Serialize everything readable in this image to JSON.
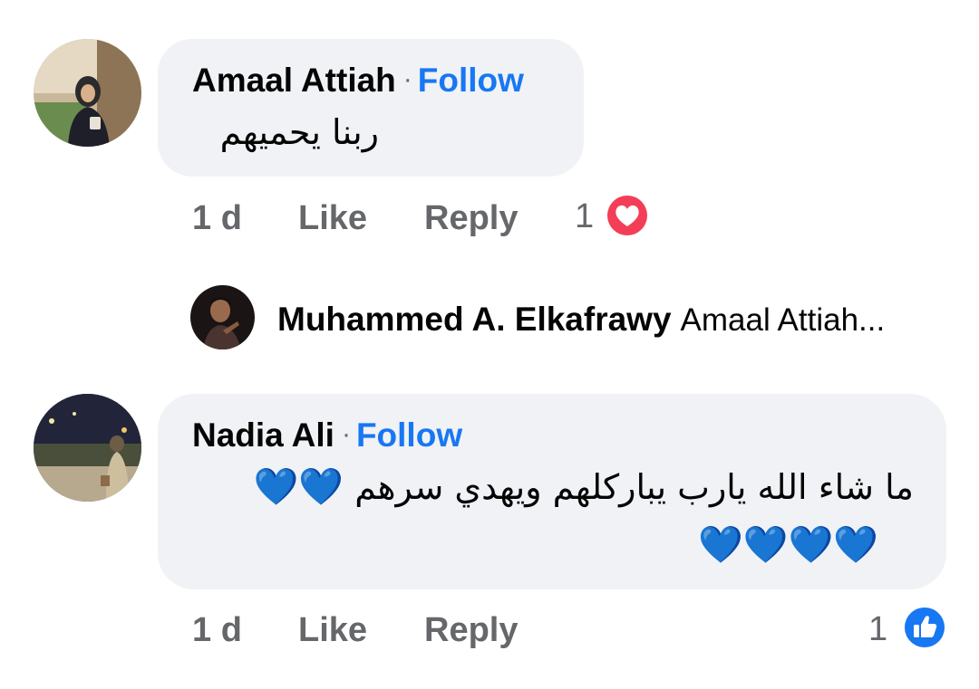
{
  "comments": [
    {
      "author": "Amaal Attiah",
      "follow_label": "Follow",
      "separator": "·",
      "text": "ربنا يحميهم",
      "time": "1 d",
      "like_label": "Like",
      "reply_label": "Reply",
      "reaction_count": "1",
      "reaction_icon": "love-reaction-icon"
    },
    {
      "author": "Nadia Ali",
      "follow_label": "Follow",
      "separator": "·",
      "text_line1": "ما شاء الله يارب يباركلهم ويهدي سرهم",
      "hearts_line1": "💙💙",
      "hearts_line2": "💙💙💙💙",
      "time": "1 d",
      "like_label": "Like",
      "reply_label": "Reply",
      "reaction_count": "1",
      "reaction_icon": "like-reaction-icon"
    }
  ],
  "reply": {
    "author": "Muhammed A. Elkafrawy",
    "preview": "Amaal Attiah..."
  },
  "colors": {
    "bubble": "#f0f2f5",
    "link_blue": "#1877f2",
    "meta_gray": "#65676b",
    "love_red": "#f33e58",
    "heart_blue": "#5ab7f5"
  }
}
